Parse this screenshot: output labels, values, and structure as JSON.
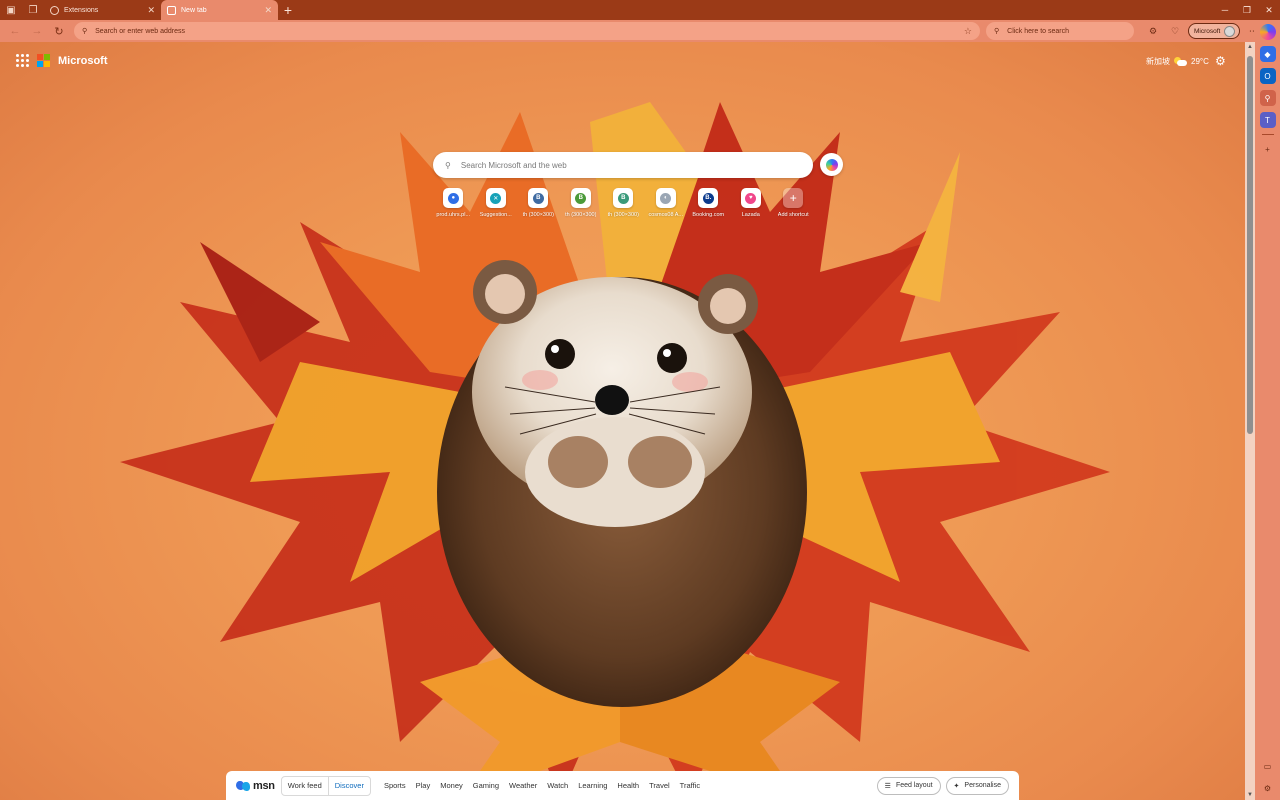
{
  "tabs": [
    {
      "label": "Extensions",
      "active": false
    },
    {
      "label": "New tab",
      "active": true
    }
  ],
  "toolbar": {
    "address_placeholder": "Search or enter web address",
    "search_placeholder": "Click here to search",
    "profile_label": "Microsoft"
  },
  "page": {
    "brand": "Microsoft",
    "weather_location": "新加坡",
    "weather_temp": "29°",
    "weather_unit": "C",
    "search_placeholder": "Search Microsoft and the web"
  },
  "shortcuts": [
    {
      "label": "prod.uhrs.pl...",
      "icon": "uhrs-icon",
      "glyph": "●",
      "color": "#2f6ee6"
    },
    {
      "label": "Suggestion...",
      "icon": "suggestion-icon",
      "glyph": "✕",
      "color": "#17a2b8"
    },
    {
      "label": "th (300×300)",
      "icon": "b-badge-icon",
      "glyph": "B",
      "color": "#3f6aa1"
    },
    {
      "label": "th (300×300)",
      "icon": "b-badge-icon",
      "glyph": "B",
      "color": "#4b9a3a"
    },
    {
      "label": "th (300×300)",
      "icon": "b-badge-icon",
      "glyph": "B",
      "color": "#3a9a7a"
    },
    {
      "label": "cosmos08 A...",
      "icon": "cosmos-icon",
      "glyph": "◐",
      "color": "#9aa6b4"
    },
    {
      "label": "Booking.com",
      "icon": "booking-icon",
      "glyph": "B.",
      "color": "#0b3a8c"
    },
    {
      "label": "Lazada",
      "icon": "lazada-icon",
      "glyph": "♥",
      "color": "#f0468a"
    },
    {
      "label": "Add shortcut",
      "icon": "plus-icon",
      "glyph": "+",
      "color": "#ffffff"
    }
  ],
  "msn": {
    "logo": "msn",
    "feed_options": [
      "Work feed",
      "Discover"
    ],
    "active_feed": "Discover",
    "nav": [
      "Sports",
      "Play",
      "Money",
      "Gaming",
      "Weather",
      "Watch",
      "Learning",
      "Health",
      "Travel",
      "Traffic"
    ],
    "feed_layout_label": "Feed layout",
    "personalise_label": "Personalise"
  },
  "colors": {
    "tab_strip": "#9b3a17",
    "toolbar": "#e98a6c",
    "accent": "#0f6cbd"
  }
}
